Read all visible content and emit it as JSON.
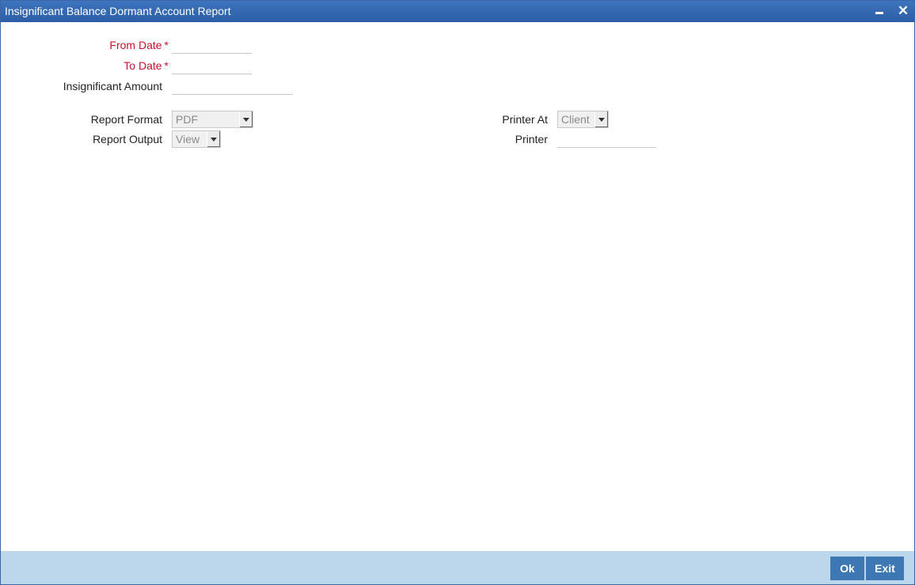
{
  "window": {
    "title": "Insignificant Balance Dormant Account Report"
  },
  "form": {
    "from_date_label": "From Date",
    "from_date_value": "",
    "to_date_label": "To Date",
    "to_date_value": "",
    "required_marker": "*",
    "insignificant_amount_label": "Insignificant Amount",
    "insignificant_amount_value": "",
    "report_format_label": "Report Format",
    "report_format_value": "PDF",
    "report_output_label": "Report Output",
    "report_output_value": "View",
    "printer_at_label": "Printer At",
    "printer_at_value": "Client",
    "printer_label": "Printer",
    "printer_value": ""
  },
  "footer": {
    "ok_label": "Ok",
    "exit_label": "Exit"
  },
  "colors": {
    "titlebar": "#2f64ab",
    "required_label": "#c8102e",
    "footer": "#bcd6ec",
    "button": "#3d78b4"
  }
}
